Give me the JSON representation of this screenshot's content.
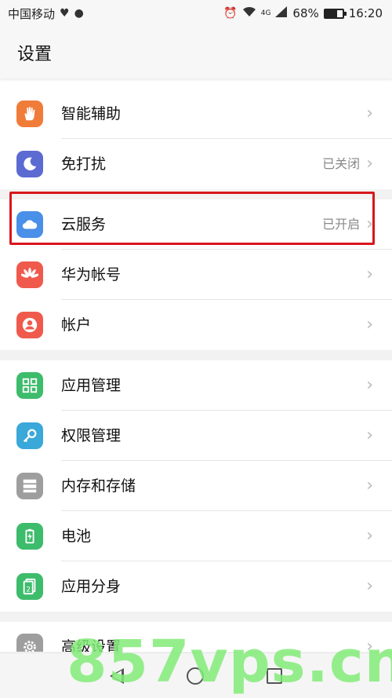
{
  "statusbar": {
    "carrier": "中国移动",
    "network": "4G",
    "battery": "68%",
    "battery_level": 0.68,
    "time": "16:20"
  },
  "header": {
    "title": "设置"
  },
  "groups": [
    {
      "items": [
        {
          "label": "智能辅助",
          "status": "",
          "icon": "hand-icon",
          "color": "#f07c3a"
        },
        {
          "label": "免打扰",
          "status": "已关闭",
          "icon": "moon-icon",
          "color": "#5c6bd1"
        }
      ]
    },
    {
      "items": [
        {
          "label": "云服务",
          "status": "已开启",
          "icon": "cloud-icon",
          "color": "#4a8fe8"
        },
        {
          "label": "华为帐号",
          "status": "",
          "icon": "huawei-logo-icon",
          "color": "#ef5a4d"
        },
        {
          "label": "帐户",
          "status": "",
          "icon": "user-icon",
          "color": "#ef5a4d"
        }
      ]
    },
    {
      "items": [
        {
          "label": "应用管理",
          "status": "",
          "icon": "grid-icon",
          "color": "#3dbc6b"
        },
        {
          "label": "权限管理",
          "status": "",
          "icon": "key-icon",
          "color": "#3aa8d8"
        },
        {
          "label": "内存和存储",
          "status": "",
          "icon": "storage-icon",
          "color": "#9e9e9e"
        },
        {
          "label": "电池",
          "status": "",
          "icon": "battery-icon",
          "color": "#3dbc6b"
        },
        {
          "label": "应用分身",
          "status": "",
          "icon": "app-twin-icon",
          "color": "#3dbc6b"
        }
      ]
    },
    {
      "items": [
        {
          "label": "高级设置",
          "status": "",
          "icon": "gear-icon",
          "color": "#9e9e9e"
        }
      ]
    }
  ],
  "watermark": "857vps.cn"
}
